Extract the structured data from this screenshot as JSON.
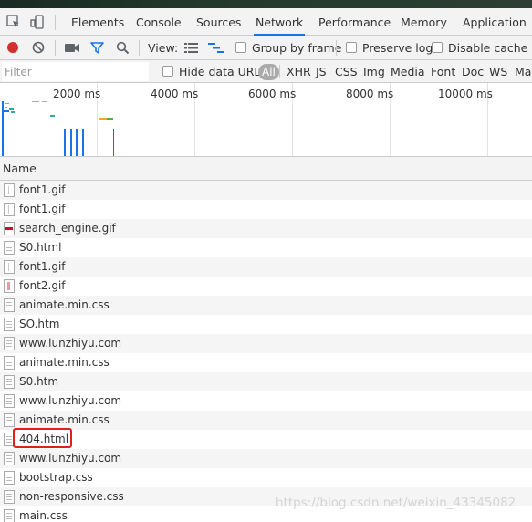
{
  "devtools": {
    "tabs": [
      {
        "label": "Elements"
      },
      {
        "label": "Console"
      },
      {
        "label": "Sources"
      },
      {
        "label": "Network"
      },
      {
        "label": "Performance"
      },
      {
        "label": "Memory"
      },
      {
        "label": "Application"
      }
    ],
    "active_tab": "Network"
  },
  "toolbar": {
    "view_label": "View:",
    "group_by_frame": "Group by frame",
    "preserve_log": "Preserve log",
    "disable_cache": "Disable cache",
    "record_color": "#d32f2f",
    "filter_icon_color": "#1a73e8"
  },
  "filter": {
    "placeholder": "Filter",
    "hide_data_urls": "Hide data URLs",
    "types": [
      "All",
      "XHR",
      "JS",
      "CSS",
      "Img",
      "Media",
      "Font",
      "Doc",
      "WS",
      "Man"
    ]
  },
  "overview": {
    "ticks": [
      "2000 ms",
      "4000 ms",
      "6000 ms",
      "8000 ms",
      "10000 ms"
    ]
  },
  "table": {
    "column_name": "Name",
    "rows": [
      {
        "name": "font1.gif",
        "icon": "image-file-icon"
      },
      {
        "name": "font1.gif",
        "icon": "image-file-icon"
      },
      {
        "name": "search_engine.gif",
        "icon": "image-file-icon"
      },
      {
        "name": "S0.html",
        "icon": "document-file-icon"
      },
      {
        "name": "font1.gif",
        "icon": "image-file-icon"
      },
      {
        "name": "font2.gif",
        "icon": "image-file-icon"
      },
      {
        "name": "animate.min.css",
        "icon": "document-file-icon"
      },
      {
        "name": "SO.htm",
        "icon": "document-file-icon"
      },
      {
        "name": "www.lunzhiyu.com",
        "icon": "document-file-icon"
      },
      {
        "name": "animate.min.css",
        "icon": "document-file-icon"
      },
      {
        "name": "S0.htm",
        "icon": "document-file-icon"
      },
      {
        "name": "www.lunzhiyu.com",
        "icon": "document-file-icon"
      },
      {
        "name": "animate.min.css",
        "icon": "document-file-icon"
      },
      {
        "name": "404.html",
        "icon": "document-file-icon"
      },
      {
        "name": "www.lunzhiyu.com",
        "icon": "document-file-icon"
      },
      {
        "name": "bootstrap.css",
        "icon": "document-file-icon"
      },
      {
        "name": "non-responsive.css",
        "icon": "document-file-icon"
      },
      {
        "name": "main.css",
        "icon": "document-file-icon"
      }
    ]
  },
  "watermark": "https://blog.csdn.net/weixin_43345082"
}
